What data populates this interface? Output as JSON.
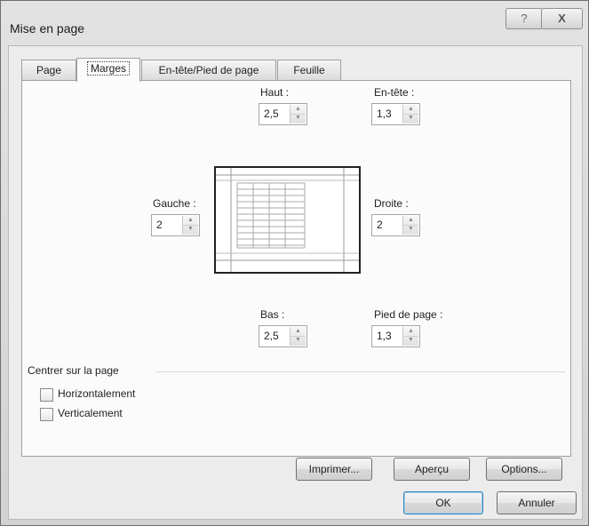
{
  "window": {
    "title": "Mise en page",
    "help_label": "?",
    "close_label": "X"
  },
  "tabs": [
    {
      "label": "Page"
    },
    {
      "label": "Marges"
    },
    {
      "label": "En-tête/Pied de page"
    },
    {
      "label": "Feuille"
    }
  ],
  "active_tab": "Marges",
  "margins": {
    "haut": {
      "label": "Haut :",
      "value": "2,5"
    },
    "entete": {
      "label": "En-tête :",
      "value": "1,3"
    },
    "gauche": {
      "label": "Gauche :",
      "value": "2"
    },
    "droite": {
      "label": "Droite :",
      "value": "2"
    },
    "bas": {
      "label": "Bas :",
      "value": "2,5"
    },
    "pied": {
      "label": "Pied de page :",
      "value": "1,3"
    }
  },
  "centrer": {
    "label": "Centrer sur la page",
    "horizontal": {
      "label": "Horizontalement",
      "checked": false
    },
    "vertical": {
      "label": "Verticalement",
      "checked": false
    }
  },
  "buttons": {
    "imprimer": "Imprimer...",
    "apercu": "Aperçu",
    "options": "Options...",
    "ok": "OK",
    "annuler": "Annuler"
  },
  "icons": {
    "spin_up": "spin-up-arrow",
    "spin_down": "spin-down-arrow",
    "preview": "page-preview"
  }
}
